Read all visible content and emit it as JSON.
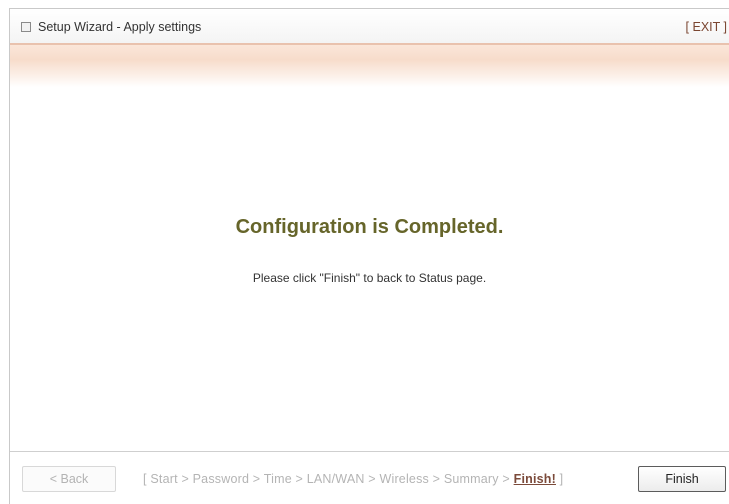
{
  "window": {
    "title": "Setup Wizard - Apply settings",
    "exit_label": "[ EXIT ]"
  },
  "main": {
    "heading": "Configuration is Completed.",
    "message": "Please click \"Finish\" to back to Status page."
  },
  "footer": {
    "back_label": "< Back",
    "finish_label": "Finish",
    "steps_open": "[ ",
    "steps": [
      "Start",
      "Password",
      "Time",
      "LAN/WAN",
      "Wireless",
      "Summary"
    ],
    "separator": " > ",
    "current_step": "Finish!",
    "steps_close": " ]"
  },
  "colors": {
    "heading": "#66652a",
    "accent_line": "#e9c2ae",
    "current_step": "#7b4a3a"
  }
}
